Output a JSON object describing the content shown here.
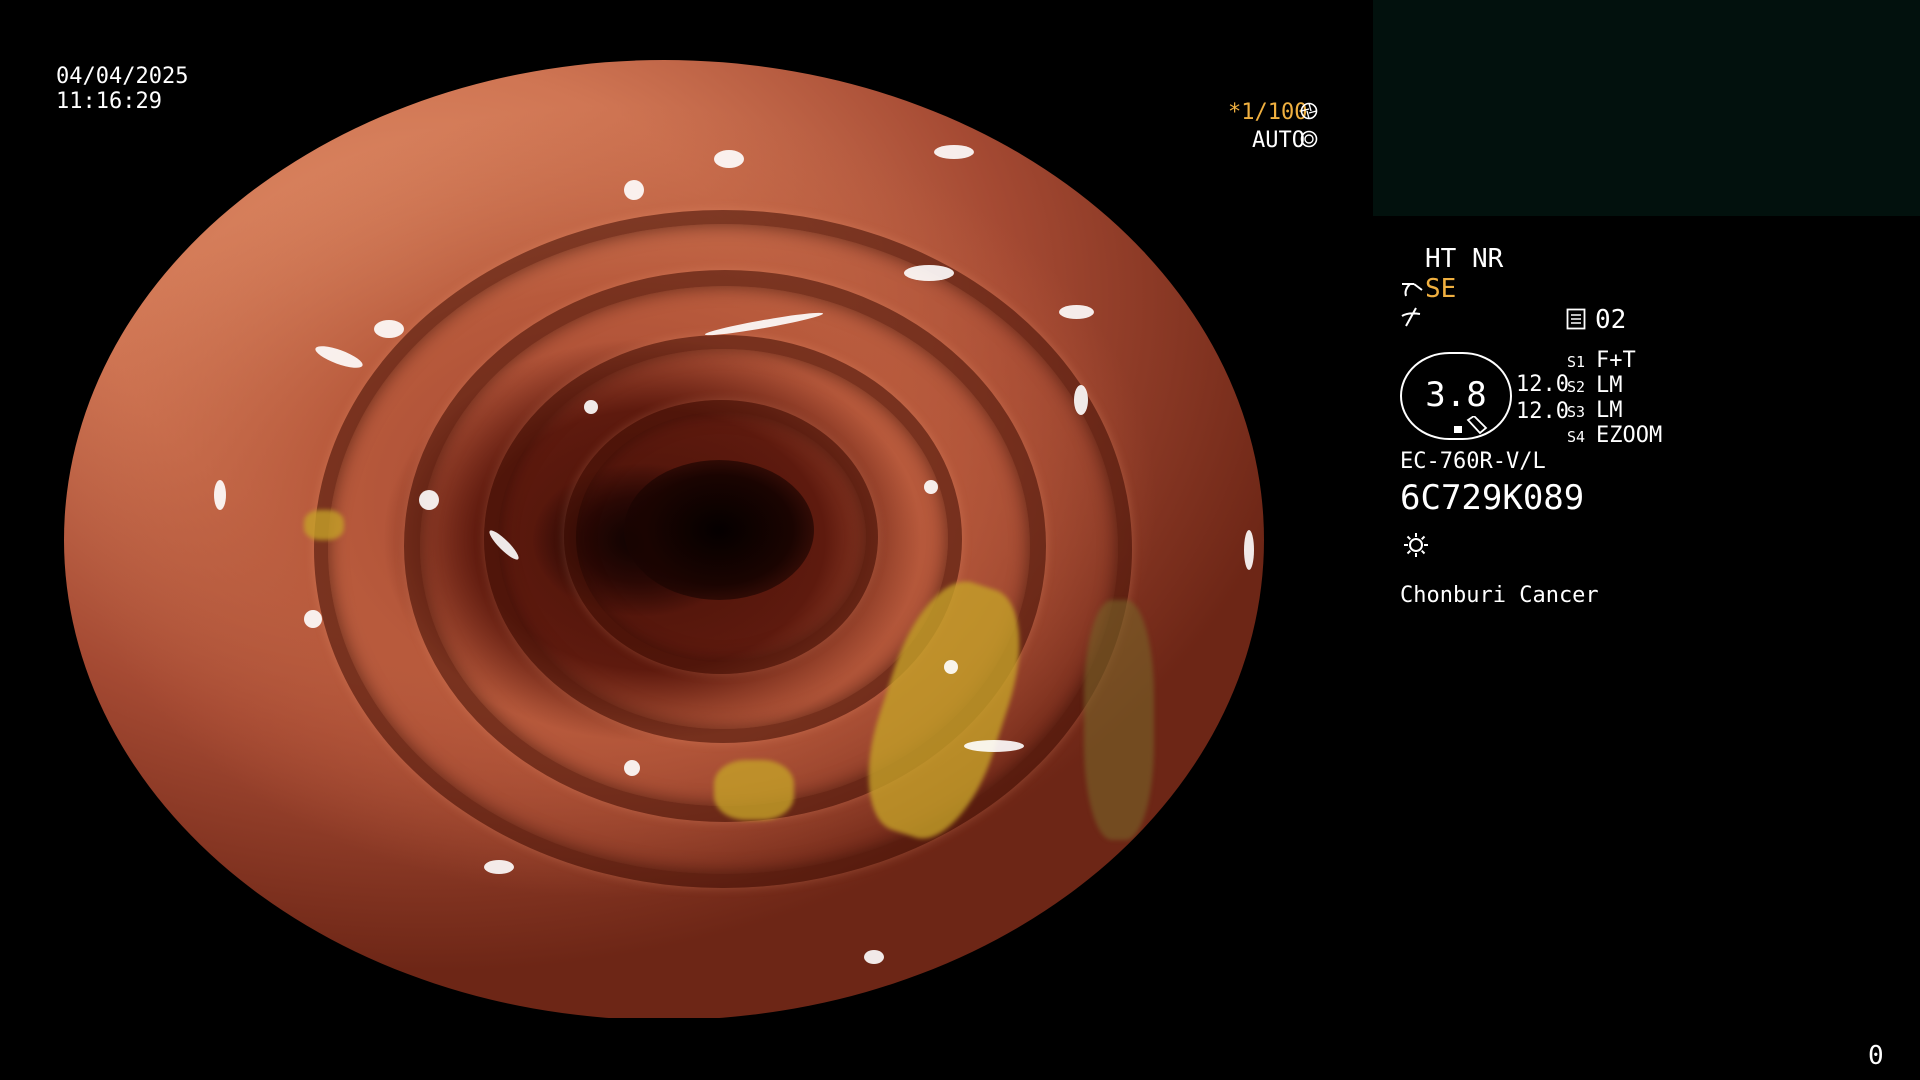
{
  "date": "04/04/2025",
  "time": "11:16:29",
  "shutter": {
    "value": "*1/100",
    "mode": "AUTO"
  },
  "settings": {
    "enhance": "HT NR",
    "mode": "SE",
    "preset_number": "02",
    "scope_value": "3.8",
    "level_top": "12.0",
    "level_bottom": "12.0",
    "switches": [
      {
        "key": "S1",
        "value": "F+T"
      },
      {
        "key": "S2",
        "value": "LM"
      },
      {
        "key": "S3",
        "value": "LM"
      },
      {
        "key": "S4",
        "value": "EZOOM"
      }
    ],
    "scope_model": "EC-760R-V/L",
    "serial": "6C729K089",
    "institution": "Chonburi Cancer"
  },
  "frame_counter": "0",
  "colors": {
    "accent": "#f0b040",
    "panel": "#02110d",
    "text": "#ffffff"
  },
  "icons": {
    "iris": "aperture-icon",
    "auto": "target-icon",
    "light": "sun-icon",
    "preset": "memory-icon",
    "mode": "scope-tip-icon",
    "filter": "slash-icon"
  }
}
